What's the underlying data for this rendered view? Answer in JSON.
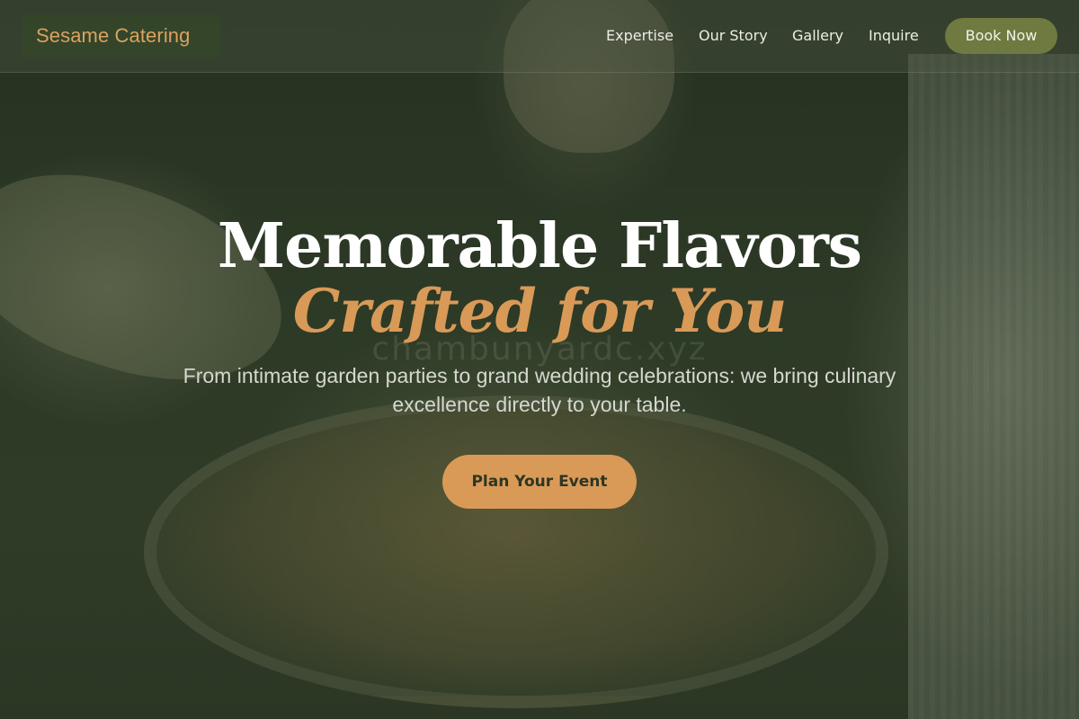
{
  "header": {
    "logo": "Sesame Catering",
    "nav": [
      "Expertise",
      "Our Story",
      "Gallery",
      "Inquire"
    ],
    "book_now": "Book Now"
  },
  "hero": {
    "headline_line1": "Memorable Flavors",
    "headline_line2": "Crafted for You",
    "subtext": "From intimate garden parties to grand wedding celebrations: we bring culinary excellence directly to your table.",
    "cta": "Plan Your Event",
    "watermark": "chambunyardc.xyz"
  },
  "colors": {
    "accent": "#d99a58",
    "button_green": "#6e7a3f",
    "overlay": "#2a3523"
  }
}
